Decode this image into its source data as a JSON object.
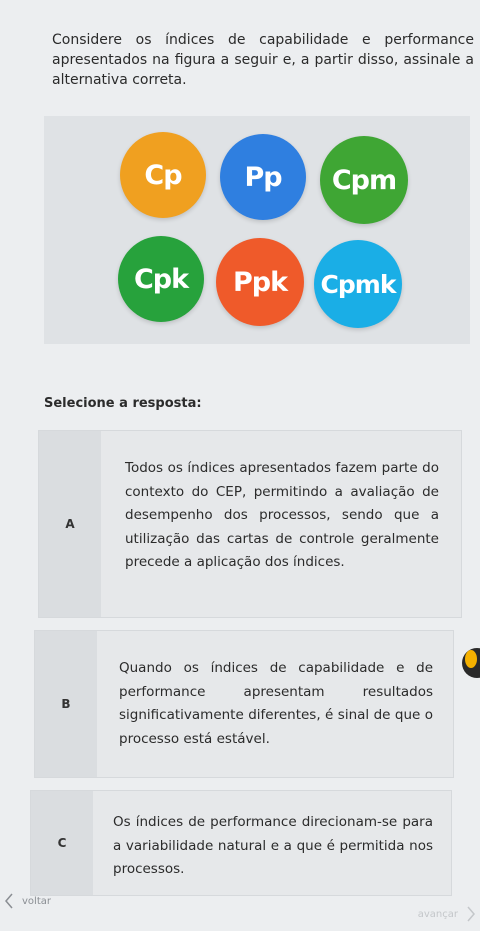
{
  "question": {
    "text": "Considere os índices de capabilidade e performance apresentados na figura a seguir e, a partir disso, assinale a alternativa correta."
  },
  "figure": {
    "indices": [
      {
        "label": "Cp",
        "color": "#f0a020"
      },
      {
        "label": "Pp",
        "color": "#2f7fe0"
      },
      {
        "label": "Cpm",
        "color": "#3fa634"
      },
      {
        "label": "Cpk",
        "color": "#27a23c"
      },
      {
        "label": "Ppk",
        "color": "#ef5a2a"
      },
      {
        "label": "Cpmk",
        "color": "#1aaee6"
      }
    ]
  },
  "answer_prompt": "Selecione a resposta:",
  "options": [
    {
      "letter": "A",
      "text": "Todos os índices apresentados fazem parte do contexto do CEP, permitindo a avaliação de desempenho dos processos, sendo que a utilização das cartas de controle geralmente precede a aplicação dos índices."
    },
    {
      "letter": "B",
      "text": "Quando os índices de capabilidade e de performance apresentam resultados significativamente diferentes, é sinal de que o processo está estável."
    },
    {
      "letter": "C",
      "text": "Os índices de performance direcionam-se para a variabilidade natural e a que é permitida nos processos."
    }
  ],
  "nav": {
    "back_label": "voltar",
    "next_label": "avançar"
  }
}
